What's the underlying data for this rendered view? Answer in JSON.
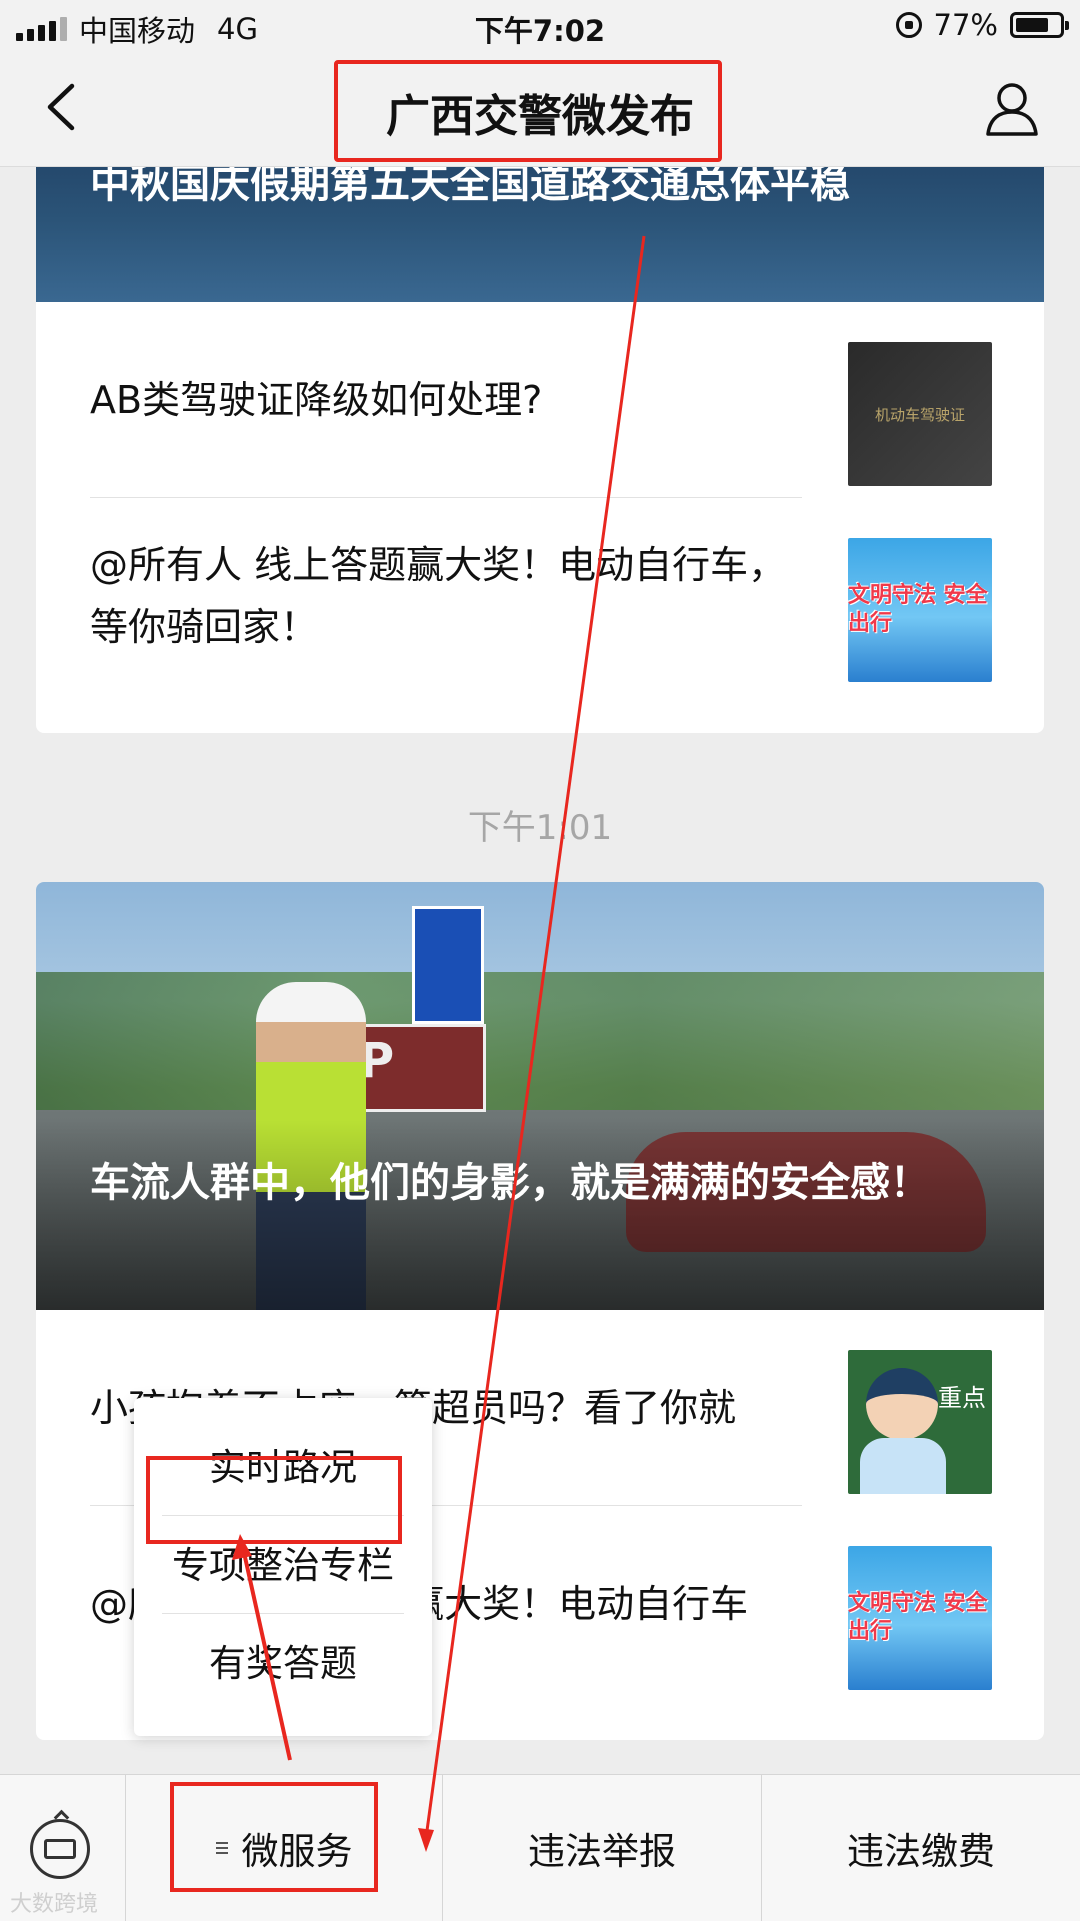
{
  "status_bar": {
    "carrier": "中国移动",
    "network": "4G",
    "time": "下午7:02",
    "battery": "77%",
    "battery_level": 0.77
  },
  "nav": {
    "title": "广西交警微发布",
    "back_icon": "chevron-left-icon",
    "profile_icon": "person-icon"
  },
  "feed": {
    "card1": {
      "hero_title": "中秋国庆假期第五天全国道路交通总体平稳",
      "items": [
        {
          "title": "AB类驾驶证降级如何处理?",
          "thumb_text": "机动车驾驶证"
        },
        {
          "title": "@所有人 线上答题赢大奖！电动自行车，等你骑回家！",
          "thumb_text": "文明守法 安全出行"
        }
      ]
    },
    "timestamp": "下午1:01",
    "card2": {
      "hero_title": "车流人群中，他们的身影，就是满满的安全感！",
      "items": [
        {
          "title": "小孩抱着不占座，算超员吗？看了你就",
          "thumb_text": "重点"
        },
        {
          "title": "@所有人 线上答题赢大奖！电动自行车",
          "thumb_text": "文明守法 安全出行"
        }
      ]
    }
  },
  "popup_menu": {
    "items": [
      "实时路况",
      "专项整治专栏",
      "有奖答题"
    ]
  },
  "bottom_bar": {
    "keyboard_icon": "keyboard-icon",
    "tabs": [
      "微服务",
      "违法举报",
      "违法缴费"
    ]
  },
  "watermark": "大数跨境",
  "annotation_color": "#e8271f"
}
